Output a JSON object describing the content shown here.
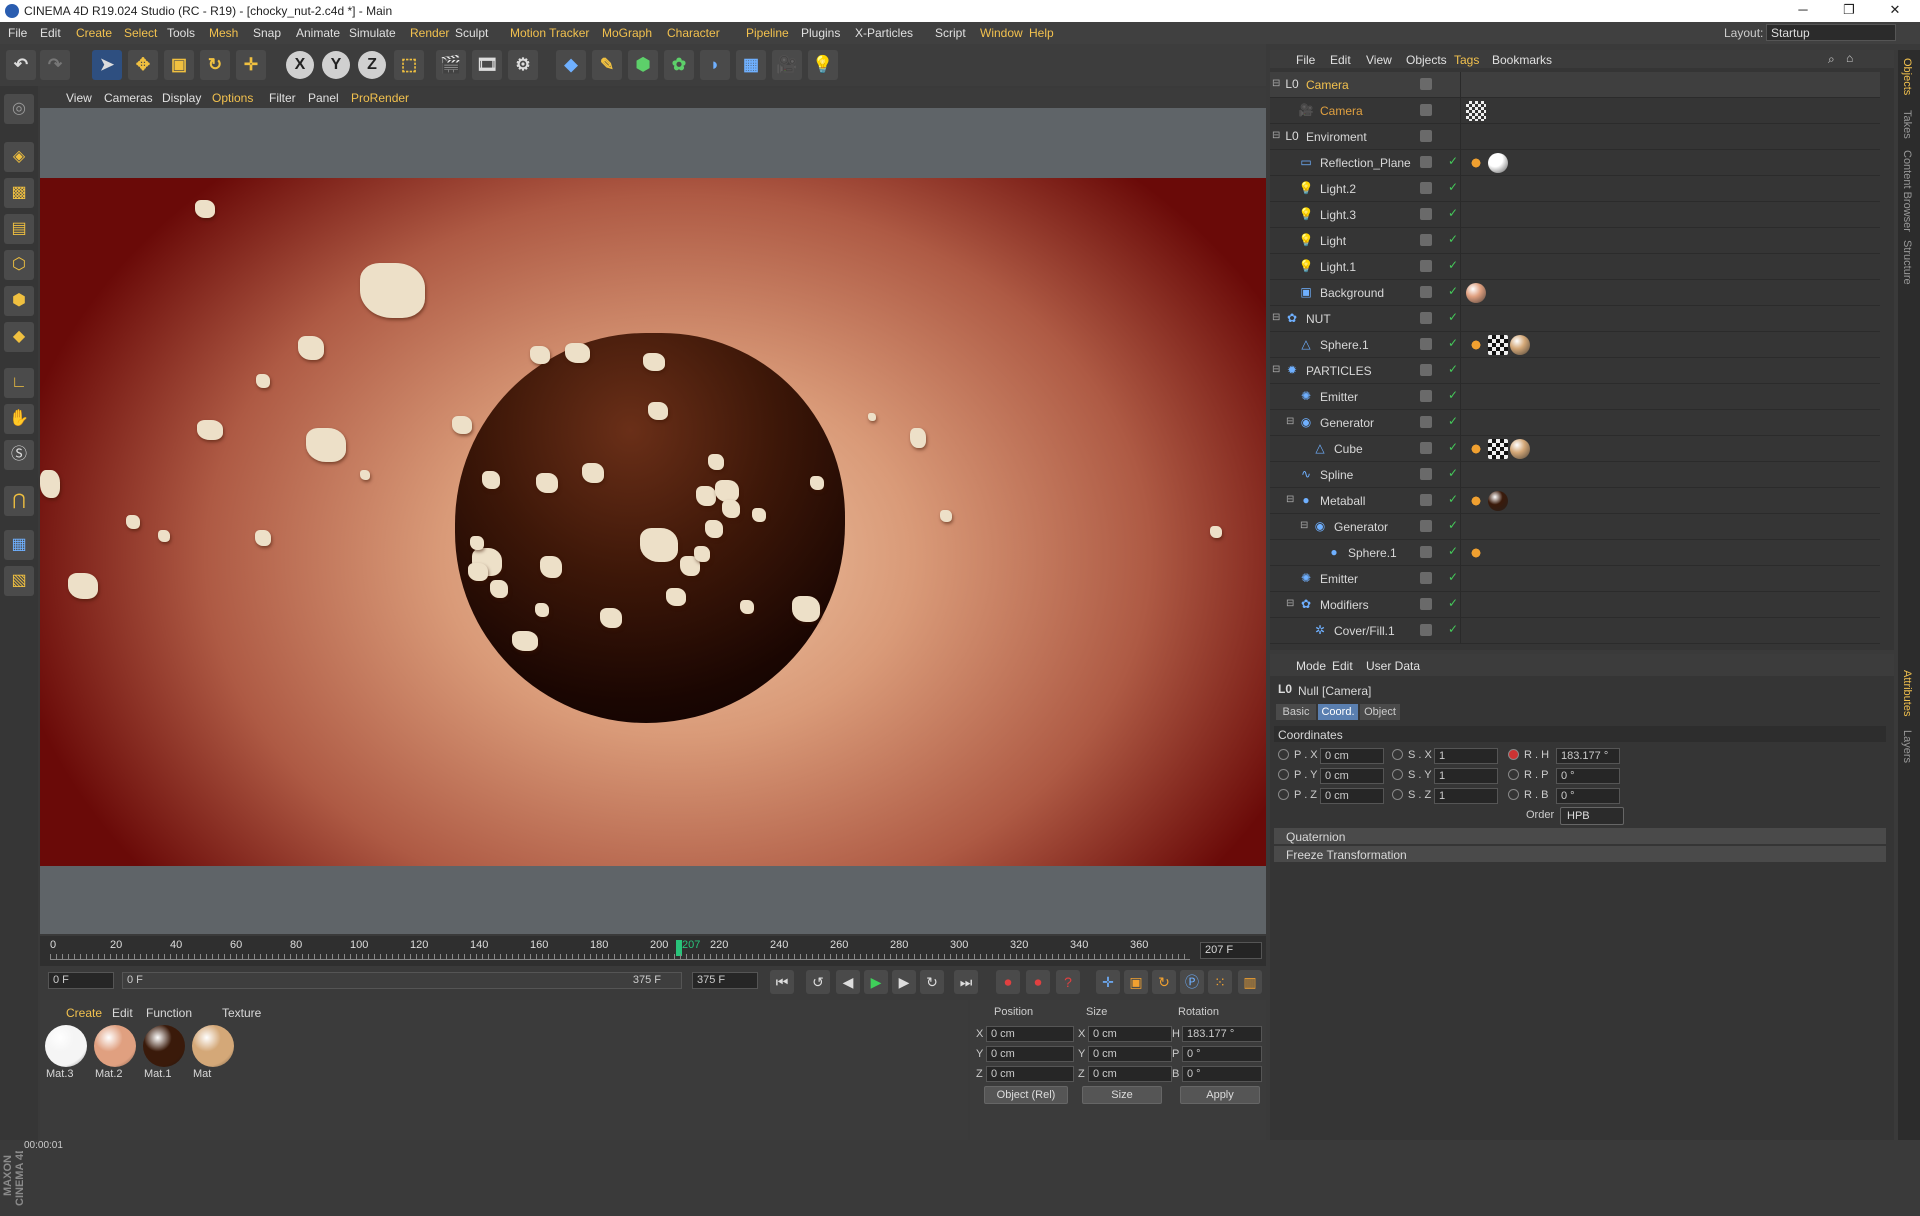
{
  "app": {
    "title": "CINEMA 4D R19.024 Studio (RC - R19) - [chocky_nut-2.c4d *] - Main",
    "window_buttons": [
      "─",
      "❐",
      "✕"
    ]
  },
  "menu": {
    "items": [
      "File",
      "Edit",
      "Create",
      "Select",
      "Tools",
      "Mesh",
      "Snap",
      "Animate",
      "Simulate",
      "Render",
      "Sculpt",
      "Motion Tracker",
      "MoGraph",
      "Character",
      "Pipeline",
      "Plugins",
      "X-Particles",
      "Script",
      "Window",
      "Help"
    ],
    "layout_label": "Layout:",
    "layout_value": "Startup"
  },
  "viewport": {
    "menu": [
      "View",
      "Cameras",
      "Display",
      "Options",
      "Filter",
      "Panel",
      "ProRender"
    ]
  },
  "timeline": {
    "ticks": [
      "0",
      "20",
      "40",
      "60",
      "80",
      "100",
      "120",
      "140",
      "160",
      "180",
      "200",
      "220",
      "240",
      "260",
      "280",
      "300",
      "320",
      "340",
      "360"
    ],
    "current": "207",
    "end_field": "207 F"
  },
  "transport": {
    "start": "0 F",
    "range_start": "0 F",
    "range_end": "375 F",
    "end": "375 F"
  },
  "materials": {
    "menu": [
      "Create",
      "Edit",
      "Function",
      "Texture"
    ],
    "items": [
      {
        "name": "Mat.3",
        "color": "#f5f5f5"
      },
      {
        "name": "Mat.2",
        "color": "#e0a080"
      },
      {
        "name": "Mat.1",
        "color": "#3a1a0a"
      },
      {
        "name": "Mat",
        "color": "#d4a878"
      }
    ]
  },
  "coords": {
    "headers": [
      "Position",
      "Size",
      "Rotation"
    ],
    "rows": [
      {
        "a": "X",
        "pv": "0 cm",
        "b": "X",
        "sv": "0 cm",
        "c": "H",
        "rv": "183.177 °"
      },
      {
        "a": "Y",
        "pv": "0 cm",
        "b": "Y",
        "sv": "0 cm",
        "c": "P",
        "rv": "0 °"
      },
      {
        "a": "Z",
        "pv": "0 cm",
        "b": "Z",
        "sv": "0 cm",
        "c": "B",
        "rv": "0 °"
      }
    ],
    "mode": "Object (Rel)",
    "size_mode": "Size",
    "apply": "Apply"
  },
  "status": {
    "time": "00:00:01"
  },
  "objects": {
    "menu": [
      "File",
      "Edit",
      "View",
      "Objects",
      "Tags",
      "Bookmarks"
    ],
    "rows": [
      {
        "name": "Camera",
        "indent": 0,
        "icon": "L0",
        "color": "#f2c14e",
        "tags": []
      },
      {
        "name": "Camera",
        "indent": 1,
        "icon": "🎥",
        "color": "#e0a040",
        "tags": [
          "cam"
        ]
      },
      {
        "name": "Enviroment",
        "indent": 0,
        "icon": "L0",
        "color": "#d8d8d8",
        "tags": []
      },
      {
        "name": "Reflection_Plane",
        "indent": 1,
        "icon": "▭",
        "color": "#d8d8d8",
        "tags": [
          "ph",
          "#ffffff"
        ]
      },
      {
        "name": "Light.2",
        "indent": 1,
        "icon": "💡",
        "color": "#d8d8d8",
        "tags": []
      },
      {
        "name": "Light.3",
        "indent": 1,
        "icon": "💡",
        "color": "#d8d8d8",
        "tags": []
      },
      {
        "name": "Light",
        "indent": 1,
        "icon": "💡",
        "color": "#d8d8d8",
        "tags": []
      },
      {
        "name": "Light.1",
        "indent": 1,
        "icon": "💡",
        "color": "#d8d8d8",
        "tags": []
      },
      {
        "name": "Background",
        "indent": 1,
        "icon": "▣",
        "color": "#d8d8d8",
        "tags": [
          "#e0a080"
        ]
      },
      {
        "name": "NUT",
        "indent": 0,
        "icon": "✿",
        "color": "#d8d8d8",
        "tags": []
      },
      {
        "name": "Sphere.1",
        "indent": 1,
        "icon": "△",
        "color": "#d8d8d8",
        "tags": [
          "ph",
          "chk",
          "#d4a878"
        ]
      },
      {
        "name": "PARTICLES",
        "indent": 0,
        "icon": "✹",
        "color": "#d8d8d8",
        "tags": []
      },
      {
        "name": "Emitter",
        "indent": 1,
        "icon": "✺",
        "color": "#d8d8d8",
        "tags": []
      },
      {
        "name": "Generator",
        "indent": 1,
        "icon": "◉",
        "color": "#d8d8d8",
        "tags": []
      },
      {
        "name": "Cube",
        "indent": 2,
        "icon": "△",
        "color": "#d8d8d8",
        "tags": [
          "ph",
          "chk",
          "#d4a878"
        ]
      },
      {
        "name": "Spline",
        "indent": 1,
        "icon": "∿",
        "color": "#d8d8d8",
        "tags": []
      },
      {
        "name": "Metaball",
        "indent": 1,
        "icon": "●",
        "color": "#d8d8d8",
        "tags": [
          "ph",
          "#3a1a0a"
        ]
      },
      {
        "name": "Generator",
        "indent": 2,
        "icon": "◉",
        "color": "#d8d8d8",
        "tags": []
      },
      {
        "name": "Sphere.1",
        "indent": 3,
        "icon": "●",
        "color": "#d8d8d8",
        "tags": [
          "ph"
        ]
      },
      {
        "name": "Emitter",
        "indent": 1,
        "icon": "✺",
        "color": "#d8d8d8",
        "tags": []
      },
      {
        "name": "Modifiers",
        "indent": 1,
        "icon": "✿",
        "color": "#d8d8d8",
        "tags": []
      },
      {
        "name": "Cover/Fill.1",
        "indent": 2,
        "icon": "✲",
        "color": "#d8d8d8",
        "tags": []
      }
    ]
  },
  "attributes": {
    "menu": [
      "Mode",
      "Edit",
      "User Data"
    ],
    "object": "Null [Camera]",
    "tabs": [
      "Basic",
      "Coord.",
      "Object"
    ],
    "active_tab": "Coord.",
    "section": "Coordinates",
    "fields": [
      {
        "l1": "P . X",
        "v1": "0 cm",
        "l2": "S . X",
        "v2": "1",
        "l3": "R . H",
        "v3": "183.177 °"
      },
      {
        "l1": "P . Y",
        "v1": "0 cm",
        "l2": "S . Y",
        "v2": "1",
        "l3": "R . P",
        "v3": "0 °"
      },
      {
        "l1": "P . Z",
        "v1": "0 cm",
        "l2": "S . Z",
        "v2": "1",
        "l3": "R . B",
        "v3": "0 °"
      }
    ],
    "order_label": "Order",
    "order_value": "HPB",
    "collapsed": [
      "Quaternion",
      "Freeze Transformation"
    ]
  },
  "side_tabs": [
    "Objects",
    "Takes",
    "Content Browser",
    "Structure",
    "Attributes",
    "Layers"
  ]
}
